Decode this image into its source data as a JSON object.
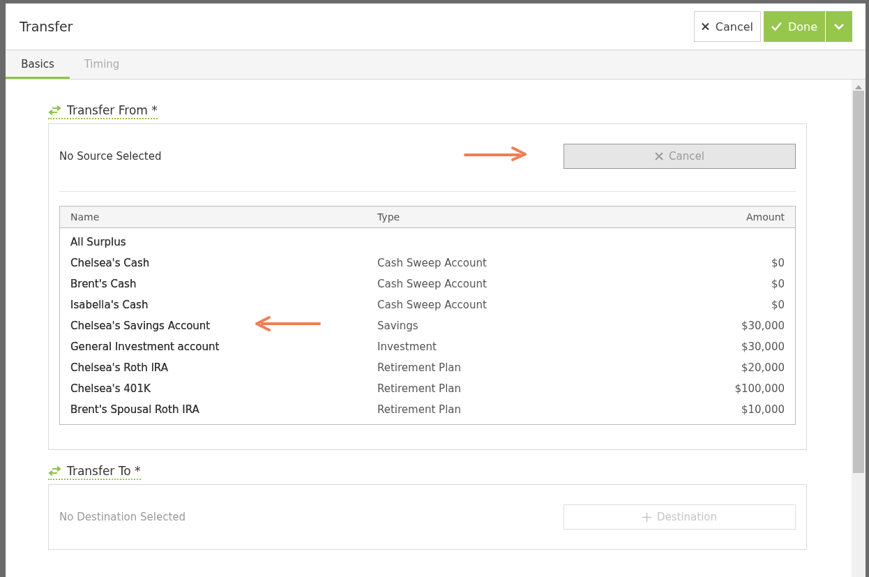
{
  "window": {
    "title": "Transfer"
  },
  "header_buttons": [
    {
      "kind": "cancel",
      "label": "Cancel"
    },
    {
      "kind": "done",
      "label": "Done"
    },
    {
      "kind": "menu"
    }
  ],
  "tabs": [
    {
      "label": "Basics",
      "selected": true
    },
    {
      "label": "Timing",
      "selected": false
    }
  ],
  "transfer_from": {
    "heading": "Transfer From *",
    "status": "No Source Selected",
    "button": {
      "kind": "cancel",
      "label": "Cancel",
      "disabled": false
    },
    "table": {
      "columns": [
        "Name",
        "Type",
        "Amount"
      ],
      "rows": [
        {
          "name": "All Surplus"
        },
        {
          "name": "Chelsea's Cash",
          "type": "Cash Sweep Account",
          "amount": "$0"
        },
        {
          "name": "Brent's Cash",
          "type": "Cash Sweep Account",
          "amount": "$0"
        },
        {
          "name": "Isabella's Cash",
          "type": "Cash Sweep Account",
          "amount": "$0"
        },
        {
          "name": "Chelsea's Savings Account",
          "type": "Savings",
          "amount": "$30,000"
        },
        {
          "name": "General Investment account",
          "type": "Investment",
          "amount": "$30,000"
        },
        {
          "name": "Chelsea's Roth IRA",
          "type": "Retirement Plan",
          "amount": "$20,000"
        },
        {
          "name": "Chelsea's 401K",
          "type": "Retirement Plan",
          "amount": "$100,000"
        },
        {
          "name": "Brent's Spousal Roth IRA",
          "type": "Retirement Plan",
          "amount": "$10,000"
        }
      ]
    }
  },
  "transfer_to": {
    "heading": "Transfer To *",
    "status": "No Destination Selected",
    "button": {
      "kind": "add",
      "label": "Destination",
      "disabled": true
    }
  }
}
